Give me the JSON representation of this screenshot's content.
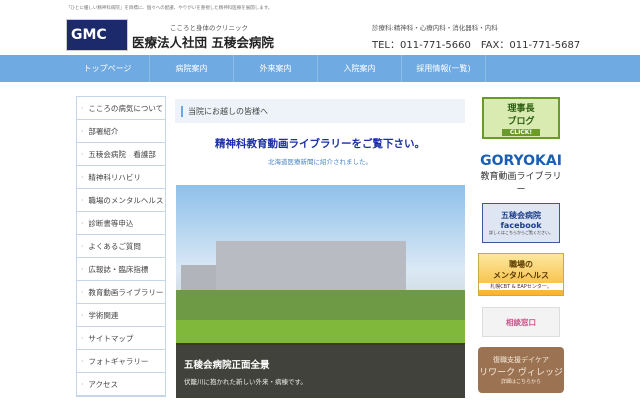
{
  "header": {
    "tagline": "「ひとに優しい精神科病院」を目標に、個々への配慮、やりがいを重視した精神科医療を展開します。",
    "logo_text": "GMC",
    "catchphrase": "こころと身体のクリニック",
    "hospital_name": "医療法人社団 五稜会病院",
    "departments": "診療科:精神科・心療内科・消化器科・内科",
    "contact": "TEL：011-771-5660　FAX：011-771-5687"
  },
  "nav": [
    "トップページ",
    "病院案内",
    "外来案内",
    "入院案内",
    "採用情報(一覧)"
  ],
  "sidebar": [
    "こころの病気について",
    "部署紹介",
    "五稜会病院　看護部",
    "精神科リハビリ",
    "職場のメンタルヘルス",
    "診断書等申込",
    "よくあるご質問",
    "広報誌・臨床指標",
    "教育動画ライブラリー",
    "学術関連",
    "サイトマップ",
    "フォトギャラリー",
    "アクセス"
  ],
  "main": {
    "heading": "当院にお越しの皆様へ",
    "library_link": "精神科教育動画ライブラリーをご覧下さい。",
    "library_note": "北海道医療新聞に紹介されました。",
    "photo_title": "五稜会病院正面全景",
    "photo_caption": "伏籠川に抱かれた新しい外来・病棟です。"
  },
  "banners": {
    "blog_title": "理事長",
    "blog_sub": "ブログ",
    "blog_click": "CLICK!",
    "goryokai": "GORYOKAI",
    "goryokai_sub": "教育動画ライブラリー",
    "fb_name": "五稜会病院",
    "fb": "facebook",
    "fb_note": "詳しくはこちらからご覧ください。",
    "mh_title": "職場の",
    "mh_title2": "メンタルヘルス",
    "mh_sub": "札幌CBT & EAPセンター。",
    "consult": "相談窓口",
    "daycare1": "復職支援デイケア",
    "daycare2": "リワーク ヴィレッジ",
    "daycare3": "詳細はこちらから"
  }
}
